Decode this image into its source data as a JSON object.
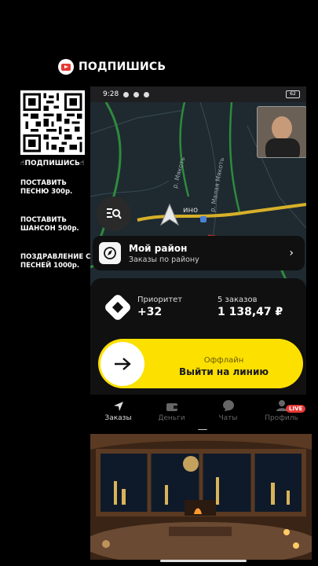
{
  "banner": {
    "text": "ПОДПИШИСЬ",
    "icon": "youtube-icon"
  },
  "left": {
    "qr_caption": "☝ПОДПИШИСЬ☝",
    "offer1": "ПОСТАВИТЬ ПЕСНЮ 300р.",
    "offer2": "ПОСТАВИТЬ ШАНСОН 500р.",
    "offer3": "ПОЗДРАВЛЕНИЕ С ПЕСНЕЙ 1000р."
  },
  "status_bar": {
    "time": "9:28",
    "battery": "62"
  },
  "map": {
    "place_label": "ино",
    "street1": "р. Мякоть",
    "street2": "р. Малая Мякоть"
  },
  "district": {
    "title": "Мой район",
    "subtitle": "Заказы по району"
  },
  "stats": {
    "priority_label": "Приоритет",
    "priority_value": "+32",
    "orders_label": "5 заказов",
    "orders_value": "1 138,47 ₽"
  },
  "go_online": {
    "status": "Оффлайн",
    "label": "Выйти на линию"
  },
  "tabs": [
    {
      "label": "Заказы",
      "icon": "navigation-icon"
    },
    {
      "label": "Деньги",
      "icon": "wallet-icon"
    },
    {
      "label": "Чаты",
      "icon": "chat-icon"
    },
    {
      "label": "Профиль",
      "icon": "profile-icon"
    }
  ],
  "live_badge": "LIVE",
  "colors": {
    "accent": "#fce000",
    "live": "#e53935",
    "map_bg": "#1e2a30"
  }
}
